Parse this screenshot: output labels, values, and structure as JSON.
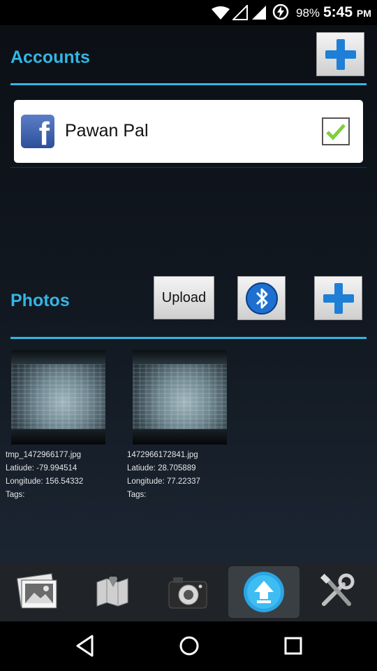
{
  "status_bar": {
    "battery_percent": "98%",
    "time": "5:45",
    "ampm": "PM",
    "icons": [
      "wifi-icon",
      "signal-empty-icon",
      "signal-full-icon",
      "charging-icon"
    ]
  },
  "accounts": {
    "title": "Accounts",
    "add_button_icon": "plus-icon",
    "items": [
      {
        "name": "Pawan Pal",
        "service_icon": "facebook-icon",
        "checked": true
      }
    ]
  },
  "photos": {
    "title": "Photos",
    "upload_label": "Upload",
    "bluetooth_icon": "bluetooth-icon",
    "add_button_icon": "plus-icon",
    "items": [
      {
        "filename": "tmp_1472966177.jpg",
        "latitude": "Latiude: -79.994514",
        "longitude": "Longitude: 156.54332",
        "tags": "Tags:"
      },
      {
        "filename": "1472966172841.jpg",
        "latitude": "Latiude: 28.705889",
        "longitude": "Longitude: 77.22337",
        "tags": "Tags:"
      }
    ]
  },
  "tabs": [
    {
      "icon": "gallery-icon",
      "active": false
    },
    {
      "icon": "map-icon",
      "active": false
    },
    {
      "icon": "camera-icon",
      "active": false
    },
    {
      "icon": "upload-icon",
      "active": true
    },
    {
      "icon": "tools-icon",
      "active": false
    }
  ],
  "nav": [
    "back-icon",
    "home-icon",
    "recents-icon"
  ],
  "colors": {
    "accent": "#33b5e5",
    "plus_blue": "#1f7fd6"
  }
}
